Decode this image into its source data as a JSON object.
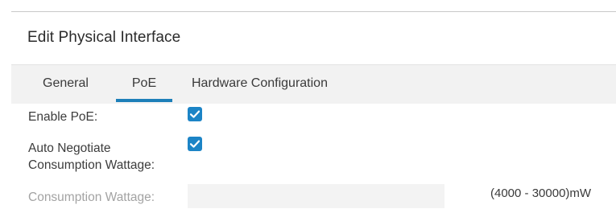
{
  "dialog": {
    "title": "Edit Physical Interface"
  },
  "tabs": {
    "general": "General",
    "poe": "PoE",
    "hardware": "Hardware Configuration",
    "active": "PoE"
  },
  "form": {
    "enable_poe": {
      "label": "Enable PoE:",
      "checked": true
    },
    "auto_negotiate": {
      "label_line1": "Auto Negotiate",
      "label_line2": "Consumption Wattage:",
      "checked": true
    },
    "consumption_wattage": {
      "label": "Consumption Wattage:",
      "value": "",
      "disabled": true,
      "range_hint": "(4000 - 30000)mW"
    }
  },
  "colors": {
    "accent": "#1c84c6",
    "tab_bar_bg": "#f2f2f2",
    "disabled_text": "#a3a3a3"
  }
}
